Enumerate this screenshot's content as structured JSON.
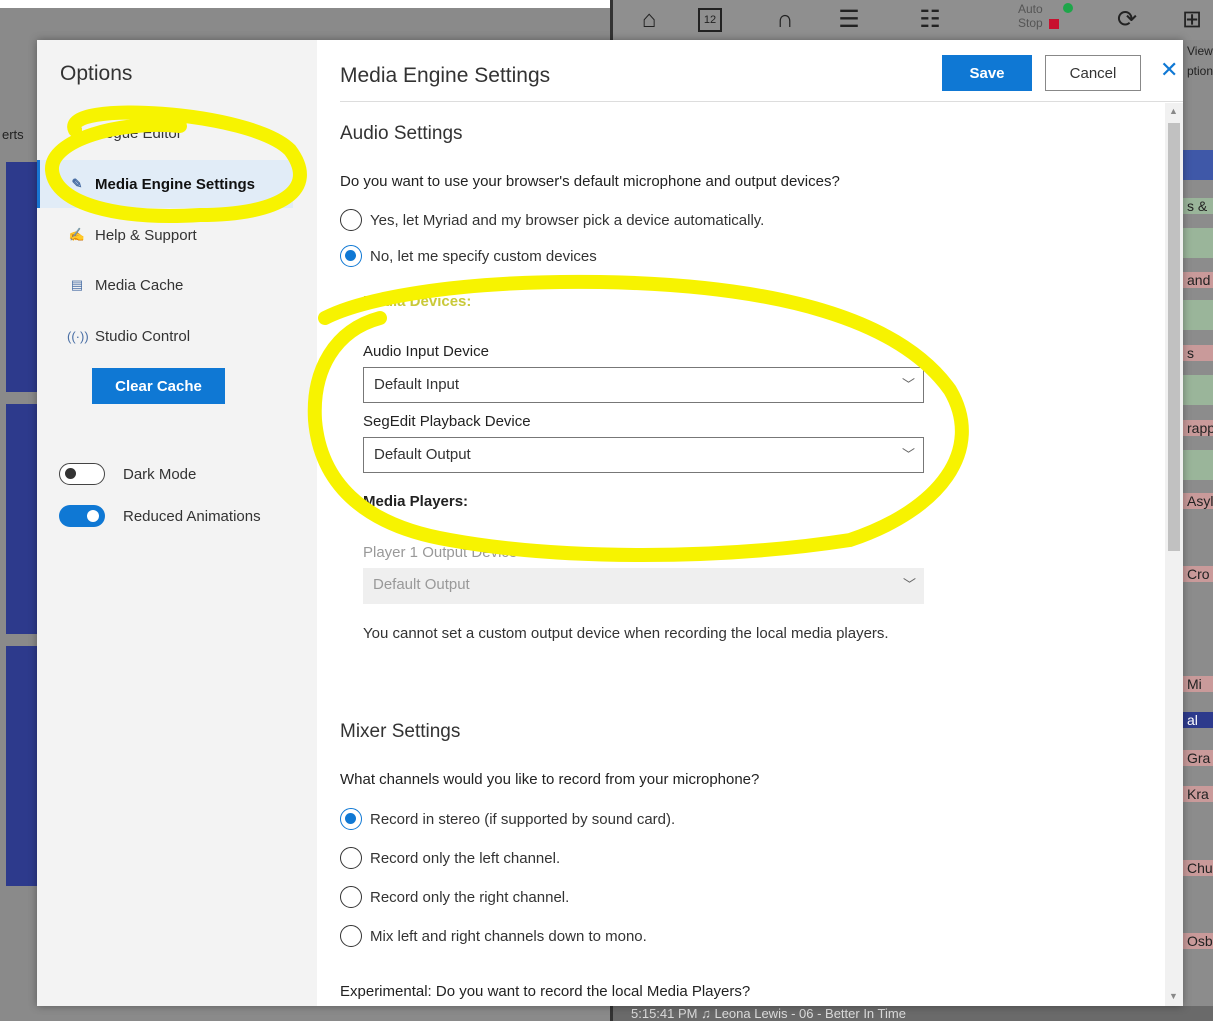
{
  "background": {
    "left_label": "erts",
    "toolbar": {
      "auto_label": "Auto",
      "stop_label": "Stop",
      "day_number": "12"
    },
    "right_fragments": [
      "View",
      "ption",
      "s &",
      "and",
      "s",
      "rapp",
      "Asylu",
      "Cro",
      "Mi",
      "al",
      "Gra",
      "Kra",
      "Chu",
      "Osbo"
    ],
    "bottom_status": "5:15:41 PM    ♫  Leona Lewis - 06 - Better In Time"
  },
  "sidebar": {
    "title": "Options",
    "items": [
      {
        "label": "Segue Editor",
        "icon": "segue-editor-icon"
      },
      {
        "label": "Media Engine Settings",
        "icon": "pen-icon"
      },
      {
        "label": "Help & Support",
        "icon": "help-icon"
      },
      {
        "label": "Media Cache",
        "icon": "media-cache-icon"
      },
      {
        "label": "Studio Control",
        "icon": "broadcast-icon"
      }
    ],
    "clear_cache_label": "Clear Cache",
    "toggles": [
      {
        "label": "Dark Mode",
        "on": false
      },
      {
        "label": "Reduced Animations",
        "on": true
      }
    ]
  },
  "main": {
    "title": "Media Engine Settings",
    "save_label": "Save",
    "cancel_label": "Cancel",
    "audio": {
      "title": "Audio Settings",
      "question": "Do you want to use your browser's default microphone and output devices?",
      "options": [
        {
          "label": "Yes, let Myriad and my browser pick a device automatically.",
          "checked": false
        },
        {
          "label": "No, let me specify custom devices",
          "checked": true
        }
      ],
      "media_devices_label": "Media Devices:",
      "input_device_label": "Audio Input Device",
      "input_device_value": "Default Input",
      "playback_device_label": "SegEdit Playback Device",
      "playback_device_value": "Default Output",
      "media_players_label": "Media Players:",
      "player1_label": "Player 1 Output Device",
      "player1_value": "Default Output",
      "note": "You cannot set a custom output device when recording the local media players."
    },
    "mixer": {
      "title": "Mixer Settings",
      "question": "What channels would you like to record from your microphone?",
      "options": [
        {
          "label": "Record in stereo (if supported by sound card).",
          "checked": true
        },
        {
          "label": "Record only the left channel.",
          "checked": false
        },
        {
          "label": "Record only the right channel.",
          "checked": false
        },
        {
          "label": "Mix left and right channels down to mono.",
          "checked": false
        }
      ]
    },
    "experimental_question": "Experimental: Do you want to record the local Media Players?"
  },
  "colors": {
    "accent": "#0f78d4",
    "highlight": "#f7f300"
  }
}
